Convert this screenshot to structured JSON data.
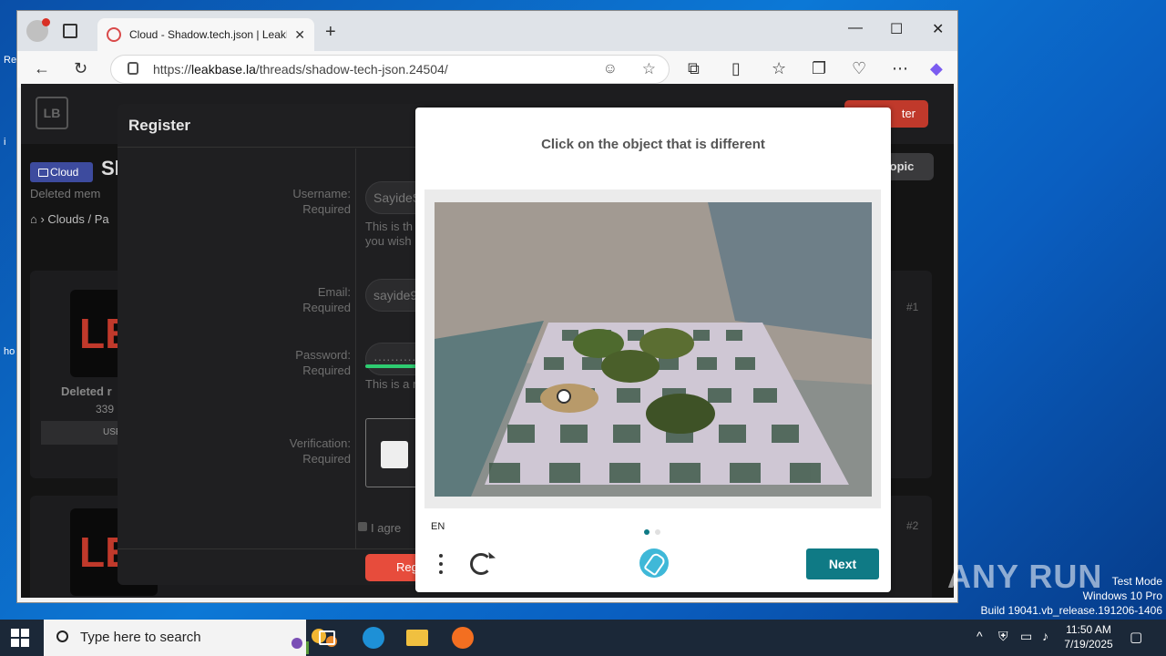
{
  "browser": {
    "tab_title": "Cloud - Shadow.tech.json | LeakBa",
    "tab_close": "✕",
    "new_tab": "+",
    "url_prefix": "https://",
    "url_host": "leakbase.la",
    "url_path": "/threads/shadow-tech-json.24504/",
    "minimize": "—",
    "maximize": "☐",
    "close": "✕"
  },
  "site": {
    "logo": "LB",
    "register_top": "ter",
    "topic_btn": "opic",
    "category_badge": "Cloud",
    "thread_title_partial": "Sh",
    "deleted_member": "Deleted mem",
    "breadcrumb": "Clouds / Pa",
    "user_name_partial": "Deleted r",
    "user_count_partial": "339",
    "user_rank_partial": "USE",
    "post1_num": "#1",
    "post2_num": "#2",
    "avatar_text": "LE"
  },
  "register": {
    "title": "Register",
    "username_label": "Username:",
    "username_req": "Required",
    "username_value": "SayideS",
    "username_help": "This is th\nyou wish",
    "email_label": "Email:",
    "email_req": "Required",
    "email_value": "sayide9",
    "password_label": "Password:",
    "password_req": "Required",
    "password_value": "··········",
    "password_help": "This is a re",
    "verification_label": "Verification:",
    "verification_req": "Required",
    "agree_partial": "I agre",
    "submit_partial": "Regi"
  },
  "captcha": {
    "prompt": "Click on the object that is different",
    "language": "EN",
    "next_label": "Next",
    "page_dots": 2,
    "active_dot": 1,
    "accent_color": "#0f7a85"
  },
  "taskbar": {
    "search_placeholder": "Type here to search",
    "time": "11:50 AM",
    "date": "7/19/2025"
  },
  "watermark": {
    "brand": "ANY RUN",
    "mode": "Test Mode",
    "os": "Windows 10 Pro",
    "build": "Build 19041.vb_release.191206-1406"
  }
}
